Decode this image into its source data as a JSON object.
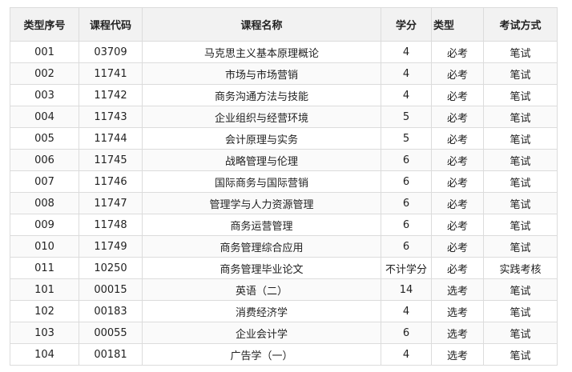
{
  "table": {
    "headers": {
      "seq": "类型序号",
      "code": "课程代码",
      "name": "课程名称",
      "credit": "学分",
      "type": "类型",
      "exam": "考试方式"
    },
    "rows": [
      {
        "seq": "001",
        "code": "03709",
        "name": "马克思主义基本原理概论",
        "credit": "4",
        "type": "必考",
        "exam": "笔试"
      },
      {
        "seq": "002",
        "code": "11741",
        "name": "市场与市场营销",
        "credit": "4",
        "type": "必考",
        "exam": "笔试"
      },
      {
        "seq": "003",
        "code": "11742",
        "name": "商务沟通方法与技能",
        "credit": "4",
        "type": "必考",
        "exam": "笔试"
      },
      {
        "seq": "004",
        "code": "11743",
        "name": "企业组织与经营环境",
        "credit": "5",
        "type": "必考",
        "exam": "笔试"
      },
      {
        "seq": "005",
        "code": "11744",
        "name": "会计原理与实务",
        "credit": "5",
        "type": "必考",
        "exam": "笔试"
      },
      {
        "seq": "006",
        "code": "11745",
        "name": "战略管理与伦理",
        "credit": "6",
        "type": "必考",
        "exam": "笔试"
      },
      {
        "seq": "007",
        "code": "11746",
        "name": "国际商务与国际营销",
        "credit": "6",
        "type": "必考",
        "exam": "笔试"
      },
      {
        "seq": "008",
        "code": "11747",
        "name": "管理学与人力资源管理",
        "credit": "6",
        "type": "必考",
        "exam": "笔试"
      },
      {
        "seq": "009",
        "code": "11748",
        "name": "商务运营管理",
        "credit": "6",
        "type": "必考",
        "exam": "笔试"
      },
      {
        "seq": "010",
        "code": "11749",
        "name": "商务管理综合应用",
        "credit": "6",
        "type": "必考",
        "exam": "笔试"
      },
      {
        "seq": "011",
        "code": "10250",
        "name": "商务管理毕业论文",
        "credit": "不计学分",
        "type": "必考",
        "exam": "实践考核"
      },
      {
        "seq": "101",
        "code": "00015",
        "name": "英语（二）",
        "credit": "14",
        "type": "选考",
        "exam": "笔试"
      },
      {
        "seq": "102",
        "code": "00183",
        "name": "消费经济学",
        "credit": "4",
        "type": "选考",
        "exam": "笔试"
      },
      {
        "seq": "103",
        "code": "00055",
        "name": "企业会计学",
        "credit": "6",
        "type": "选考",
        "exam": "笔试"
      },
      {
        "seq": "104",
        "code": "00181",
        "name": "广告学（一）",
        "credit": "4",
        "type": "选考",
        "exam": "笔试"
      }
    ]
  }
}
